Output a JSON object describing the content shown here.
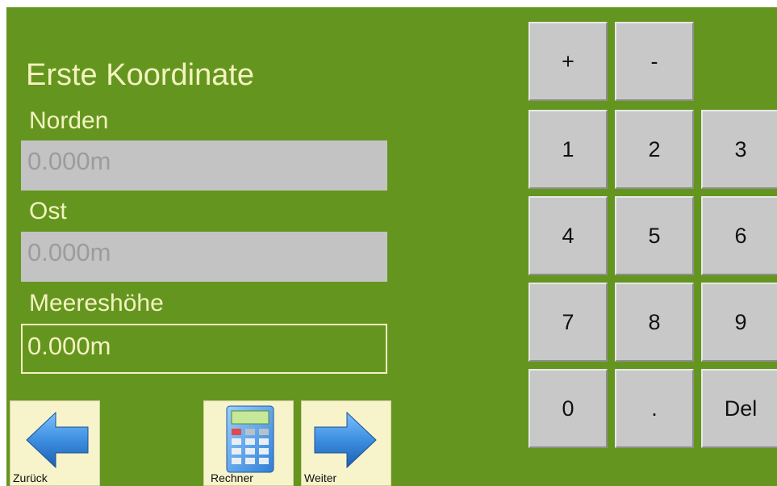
{
  "screen": {
    "title": "Erste Koordinate"
  },
  "fields": {
    "north": {
      "label": "Norden",
      "value": "0.000m",
      "state": "disabled"
    },
    "east": {
      "label": "Ost",
      "value": "0.000m",
      "state": "disabled"
    },
    "height": {
      "label": "Meereshöhe",
      "value": "0.000m",
      "state": "active"
    }
  },
  "keypad": {
    "plus": "+",
    "minus": "-",
    "k1": "1",
    "k2": "2",
    "k3": "3",
    "k4": "4",
    "k5": "5",
    "k6": "6",
    "k7": "7",
    "k8": "8",
    "k9": "9",
    "k0": "0",
    "dot": ".",
    "del": "Del"
  },
  "nav": {
    "back_label": "Zurück",
    "calc_label": "Rechner",
    "next_label": "Weiter"
  },
  "colors": {
    "background": "#64961f",
    "text": "#f4f2c0",
    "key": "#c8c8c8",
    "nav_button": "#f7f3cb",
    "arrow": "#3d8fe0"
  },
  "icons": {
    "back": "arrow-left-icon",
    "calculator": "calculator-icon",
    "next": "arrow-right-icon"
  }
}
